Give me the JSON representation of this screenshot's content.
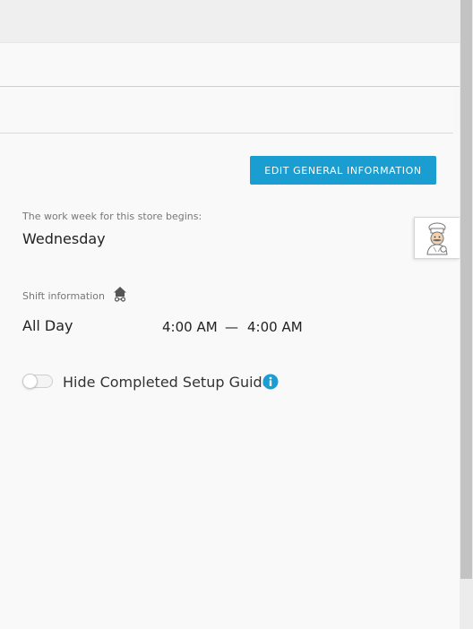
{
  "actions": {
    "edit_general_information_label": "EDIT GENERAL INFORMATION"
  },
  "work_week": {
    "label": "The work week for this store begins:",
    "value": "Wednesday"
  },
  "shift_info": {
    "label": "Shift information",
    "label_icon": "home-icon",
    "name": "All Day",
    "start_time": "4:00 AM",
    "separator": "—",
    "end_time": "4:00 AM"
  },
  "setup_guide": {
    "toggle_on": false,
    "label": "Hide Completed Setup Guide",
    "info_icon": "info-icon"
  },
  "help_widget": {
    "icon": "chef-avatar-icon"
  },
  "colors": {
    "accent": "#1a9dd0",
    "background": "#f9f9f9",
    "text": "#333333",
    "muted_text": "#777777"
  }
}
